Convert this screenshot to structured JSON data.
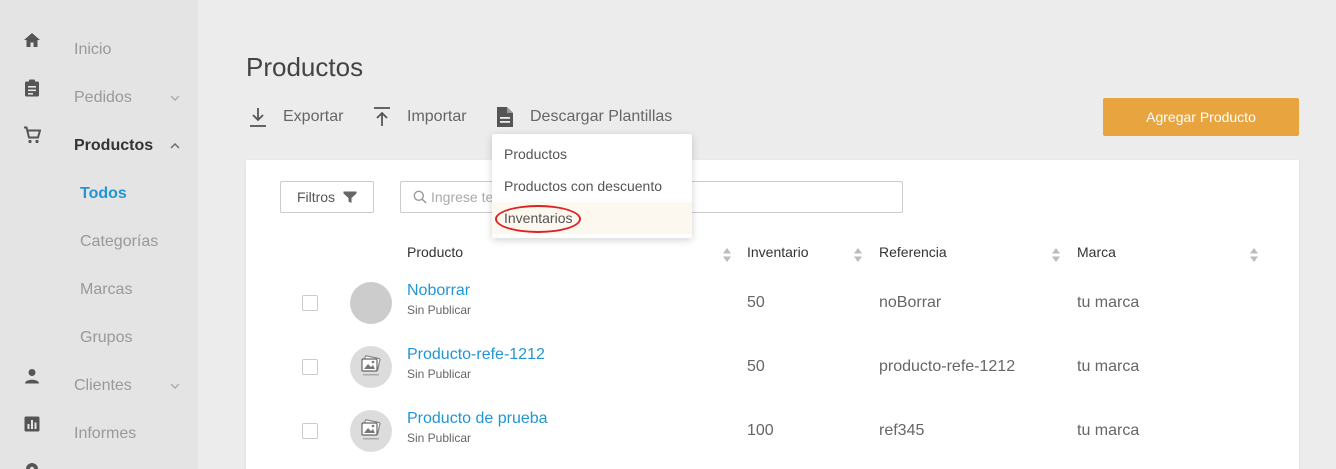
{
  "sidebar": {
    "items": [
      {
        "label": "Inicio",
        "icon": "home-icon"
      },
      {
        "label": "Pedidos",
        "icon": "clipboard-icon",
        "chevron": "down"
      },
      {
        "label": "Productos",
        "icon": "cart-icon",
        "chevron": "up",
        "active": true
      },
      {
        "label": "Clientes",
        "icon": "person-icon",
        "chevron": "down"
      },
      {
        "label": "Informes",
        "icon": "report-icon"
      }
    ],
    "sub_items": [
      {
        "label": "Todos",
        "active": true
      },
      {
        "label": "Categorías"
      },
      {
        "label": "Marcas"
      },
      {
        "label": "Grupos"
      }
    ]
  },
  "header": {
    "title": "Productos",
    "export_label": "Exportar",
    "import_label": "Importar",
    "templates_label": "Descargar Plantillas",
    "add_button": "Agregar Producto"
  },
  "dropdown": {
    "items": [
      "Productos",
      "Productos con descuento",
      "Inventarios"
    ],
    "hovered_index": 2
  },
  "toolbar": {
    "filters_label": "Filtros",
    "search_placeholder": "Ingrese texto"
  },
  "table": {
    "columns": [
      "Producto",
      "Inventario",
      "Referencia",
      "Marca"
    ],
    "rows": [
      {
        "name": "Noborrar",
        "status": "Sin Publicar",
        "inventory": "50",
        "reference": "noBorrar",
        "brand": "tu marca",
        "image": "placeholder-circle"
      },
      {
        "name": "Producto-refe-1212",
        "status": "Sin Publicar",
        "inventory": "50",
        "reference": "producto-refe-1212",
        "brand": "tu marca",
        "image": "image-placeholder"
      },
      {
        "name": "Producto de prueba",
        "status": "Sin Publicar",
        "inventory": "100",
        "reference": "ref345",
        "brand": "tu marca",
        "image": "image-placeholder"
      }
    ]
  },
  "colors": {
    "accent": "#e8a53f",
    "link": "#2196d3",
    "highlight": "#dd2222"
  }
}
